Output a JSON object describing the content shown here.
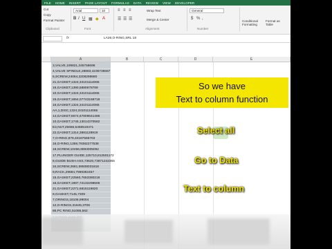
{
  "ribbon": {
    "tabs": [
      "FILE",
      "HOME",
      "INSERT",
      "PAGE LAYOUT",
      "FORMULAS",
      "DATA",
      "REVIEW",
      "VIEW",
      "DEVELOPER"
    ],
    "cut": "Cut",
    "copy": "Copy",
    "format_painter": "Format Painter",
    "font_name": "Arial",
    "font_size": "10",
    "wrap_text": "Wrap Text",
    "merge_center": "Merge & Center",
    "number_format": "General",
    "clipboard": "Clipboard",
    "font_group": "Font",
    "alignment_group": "Alignment",
    "number_group": "Number",
    "conditional_formatting": "Conditional Formatting",
    "format_as_table": "Format as Table"
  },
  "formula_bar": {
    "name_box": "",
    "fx": "fx",
    "formula": "LA26,O-RING,SRL 18"
  },
  "sheet": {
    "columns": [
      "A",
      "B",
      "C",
      "D",
      "E"
    ],
    "rows": [
      "3,VALVE,109821,345758698",
      "4,VALVE SPINDLE,28883,4235735567",
      "5,SCREW,24064,3208298680",
      "21,GASKET,1324,34101114065",
      "16,GASKET,1390,5880678789",
      "10,GASKET,1324,34101114065",
      "15,GASKET,1654,07743158718",
      "16,GASKET,1324,34101114065",
      "AA,1,DISC,1324,34101114065",
      "14,GASKET,6674,67809641486",
      "10,GASKET,1745,13014370582",
      "E2,NUT,25656,5458519471",
      "22,GASKET,1314,3881128919",
      "7,O-RING,879,40187566703",
      "16,O-RING,1359,79382277538",
      "18,SCREW,10466,8893005092",
      "17,PLUNGER GUIDE,125710,812501172",
      "8,GUIDE BUSH ASS,73620,73871242355",
      "34,SCREW,2681,59508031818",
      "9,RACK,29684,7998382457",
      "15,GASKET,22560,7653380218",
      "16,GASKET,1987,72132298506",
      "21,GASKET,2271,6815119820",
      "8,GASKET,7145,7309",
      "7,ORINGS,18106,99004",
      "12,O-RINGS,31645,3708",
      "86,PC RING,51065,562",
      "7,O-RING,3180,304"
    ]
  },
  "overlay": {
    "headline_line1": "So we have",
    "headline_line2": "Text to column function",
    "step1": "Select all",
    "step2": "Go to Data",
    "step3": "Text to column"
  },
  "colors": {
    "excel_green": "#217346",
    "caption_yellow": "#f5e600",
    "selection_gray": "#c9ced3"
  }
}
